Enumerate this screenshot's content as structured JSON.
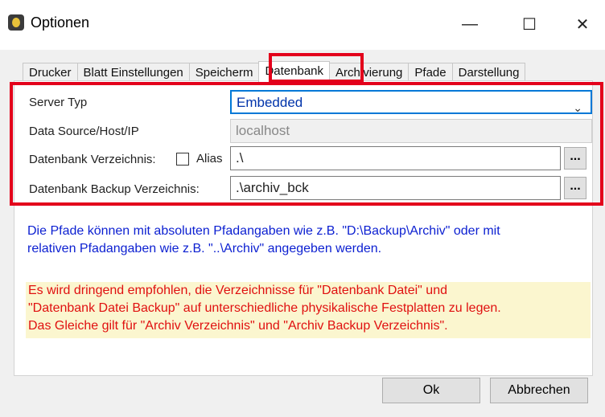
{
  "window": {
    "title": "Optionen",
    "minimize_glyph": "—",
    "maximize_glyph": "☐",
    "close_glyph": "✕"
  },
  "tabs": [
    "Drucker",
    "Blatt Einstellungen",
    "Speicherm",
    "Datenbank",
    "Archivierung",
    "Pfade",
    "Darstellung"
  ],
  "active_tab": "Datenbank",
  "form": {
    "server_type_label": "Server Typ",
    "server_type_value": "Embedded",
    "data_source_label": "Data Source/Host/IP",
    "data_source_value": "localhost",
    "db_dir_label": "Datenbank Verzeichnis:",
    "alias_label": "Alias",
    "db_dir_value": ".\\",
    "backup_dir_label": "Datenbank Backup Verzeichnis:",
    "backup_dir_value": ".\\archiv_bck",
    "browse_label": "..."
  },
  "info_text_line1": "Die Pfade können mit absoluten Pfadangaben wie z.B.  \"D:\\Backup\\Archiv\"  oder mit",
  "info_text_line2": "relativen Pfadangaben wie z.B.  \"..\\Archiv\"  angegeben werden.",
  "warning_line1": "Es wird dringend empfohlen, die Verzeichnisse für  \"Datenbank Datei\"  und",
  "warning_line2": "\"Datenbank Datei Backup\"  auf unterschiedliche physikalische Festplatten zu legen.",
  "warning_line3": "Das Gleiche gilt für  \"Archiv Verzeichnis\"  und  \"Archiv Backup Verzeichnis\".",
  "buttons": {
    "ok": "Ok",
    "cancel": "Abbrechen"
  },
  "colors": {
    "highlight": "#e3001b",
    "info": "#0b1fd1",
    "warning_text": "#e01010",
    "warning_bg": "#fbf6cf",
    "focus": "#0078d7"
  }
}
